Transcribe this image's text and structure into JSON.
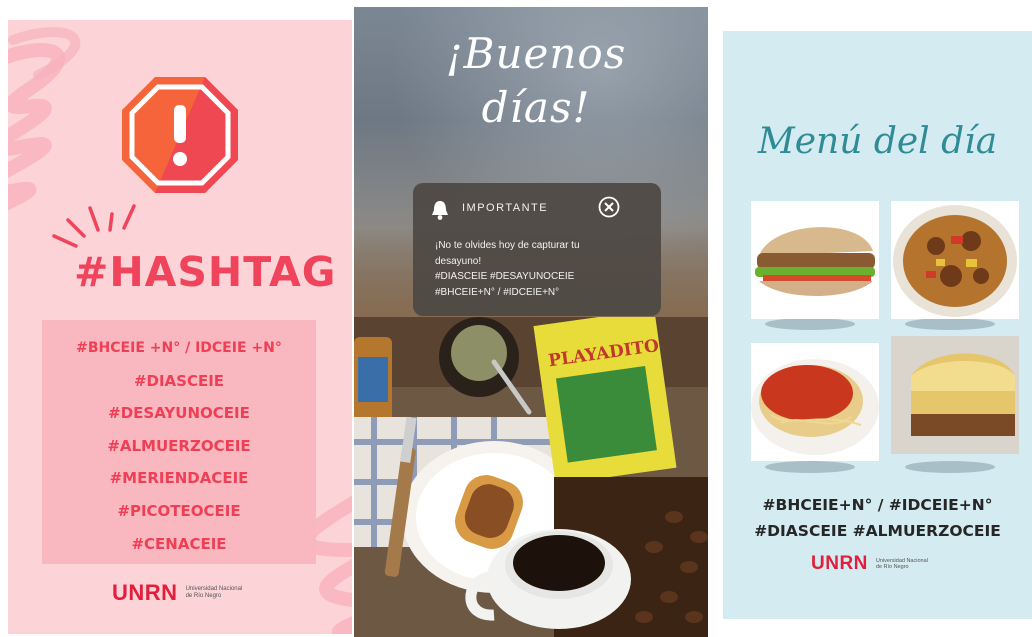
{
  "panel_hashtag": {
    "title": "#HASHTAG",
    "tags": [
      "#BHCEIE +N° / IDCEIE +N°",
      "#DIASCEIE",
      "#DESAYUNOCEIE",
      "#ALMUERZOCEIE",
      "#MERIENDACEIE",
      "#PICOTEOCEIE",
      "#CENACEIE"
    ],
    "icon": "warning-octagon-icon",
    "colors": {
      "background": "#fcd3d6",
      "accent": "#f0435c",
      "box": "#f9b8c0",
      "octagon": "#f5643a"
    }
  },
  "panel_buenos_dias": {
    "greeting_line1": "¡Buenos",
    "greeting_line2": "días!",
    "notification": {
      "title": "IMPORTANTE",
      "body_line1": "¡No te olvides  hoy de capturar tu",
      "body_line2": "desayuno!",
      "body_line3": "#DIASCEIE #DESAYUNOCEIE",
      "body_line4": "#BHCEIE+N° / #IDCEIE+N°"
    },
    "package_label": "PLAYADITO"
  },
  "panel_menu": {
    "title": "Menú del día",
    "tags_line1": "#BHCEIE+N° / #IDCEIE+N°",
    "tags_line2": "#DIASCEIE #ALMUERZOCEIE",
    "dishes": [
      "sandwich",
      "stew",
      "spaghetti",
      "pie"
    ]
  },
  "brand": {
    "name": "UNRN",
    "subtitle_line1": "Universidad Nacional",
    "subtitle_line2": "de Río Negro"
  }
}
